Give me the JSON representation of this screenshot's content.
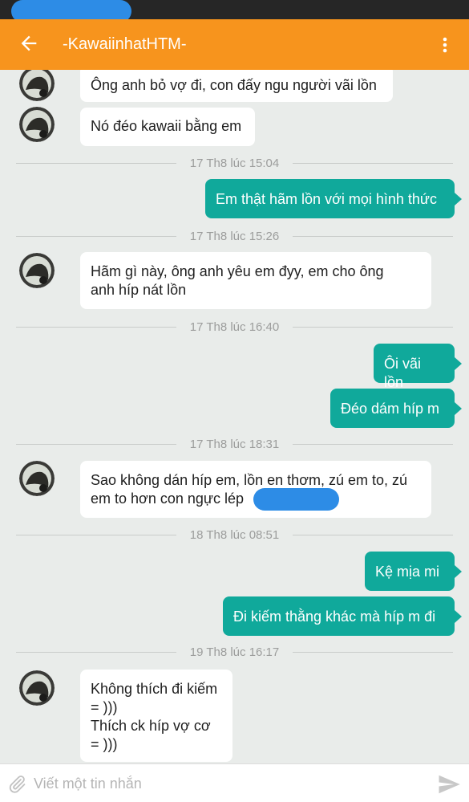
{
  "app": {
    "title": "-KawaiinhatHTM-",
    "colors": {
      "appbar": "#f7941d",
      "bubble_out": "#10a99b",
      "bubble_in": "#ffffff",
      "redaction": "#2d8ce6"
    }
  },
  "messages": [
    {
      "side": "in",
      "text": "Ông anh bỏ vợ đi, con đấy ngu người vãi lồn"
    },
    {
      "side": "in",
      "text": "Nó đéo kawaii bằng em"
    },
    {
      "divider": "17 Th8 lúc 15:04"
    },
    {
      "side": "out",
      "text": "Em thật hãm lồn với mọi hình thức"
    },
    {
      "divider": "17 Th8 lúc 15:26"
    },
    {
      "side": "in",
      "lines": [
        "Hãm gì này, ông anh yêu em đyy, em cho ông",
        "anh híp nát lồn"
      ]
    },
    {
      "divider": "17 Th8 lúc 16:40"
    },
    {
      "side": "out",
      "text": "Ôi vãi lồn"
    },
    {
      "side": "out",
      "text": "Đéo dám híp m"
    },
    {
      "divider": "17 Th8 lúc 18:31"
    },
    {
      "side": "in",
      "lines": [
        "Sao không dán híp em, lồn en thơm, zú em to, zú",
        "em to hơn con ngực lép"
      ]
    },
    {
      "divider": "18 Th8 lúc 08:51"
    },
    {
      "side": "out",
      "text": "Kệ mịa mi"
    },
    {
      "side": "out",
      "text": "Đi kiếm thằng khác mà híp m đi"
    },
    {
      "divider": "19 Th8 lúc 16:17"
    },
    {
      "side": "in",
      "lines": [
        "Không thích đi kiếm",
        "= )))",
        "Thích ck híp vợ cơ",
        "= )))"
      ]
    }
  ],
  "composer": {
    "placeholder": "Viết một tin nhắn",
    "icons": {
      "attach": "paperclip-icon",
      "send": "send-icon"
    }
  }
}
